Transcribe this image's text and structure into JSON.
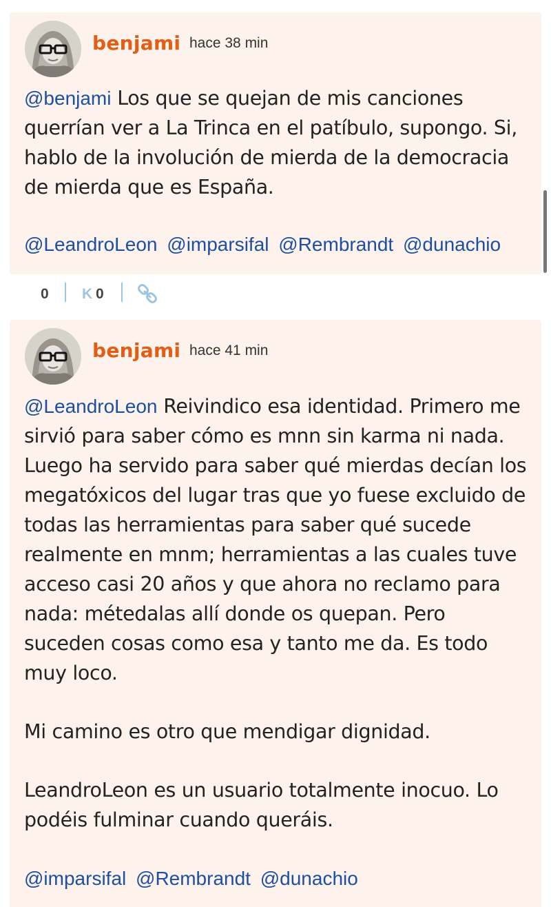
{
  "comments": [
    {
      "username": "benjami",
      "time": "hace 38 min",
      "body": {
        "mention": "@benjami",
        "text": " Los que se quejan de mis canciones querrían ver a La Trinca en el patíbulo, supongo. Si, hablo de la involución de mierda de la democracia de mierda que es España."
      },
      "mentions": [
        "@LeandroLeon",
        "@imparsifal",
        "@Rembrandt",
        "@dunachio"
      ],
      "votes": "0",
      "karma_label": "K",
      "karma": "0"
    },
    {
      "username": "benjami",
      "time": "hace 41 min",
      "body": {
        "mention": "@LeandroLeon",
        "text": " Reivindico esa identidad. Primero me sirvió para saber cómo es mnn sin karma ni nada. Luego ha servido para saber qué mierdas decían los megatóxicos del lugar tras que yo fuese excluido de todas las herramientas para saber qué sucede realmente en mnm; herramientas a las cuales tuve acceso casi 20 años y que ahora no reclamo para nada: métedalas allí donde os quepan. Pero suceden cosas como esa y tanto me da. Es todo muy loco.",
        "paragraph2": "Mi camino es otro que mendigar dignidad.",
        "paragraph3": "LeandroLeon es un usuario totalmente inocuo. Lo podéis fulminar cuando queráis."
      },
      "mentions": [
        "@imparsifal",
        "@Rembrandt",
        "@dunachio"
      ]
    }
  ],
  "icons": {
    "avatar": "avatar-image",
    "permalink": "link-icon"
  },
  "colors": {
    "username": "#e35e14",
    "mention": "#1c4fa3",
    "card_background": "#fdf3ec",
    "karma_accent": "#9ec4de"
  }
}
